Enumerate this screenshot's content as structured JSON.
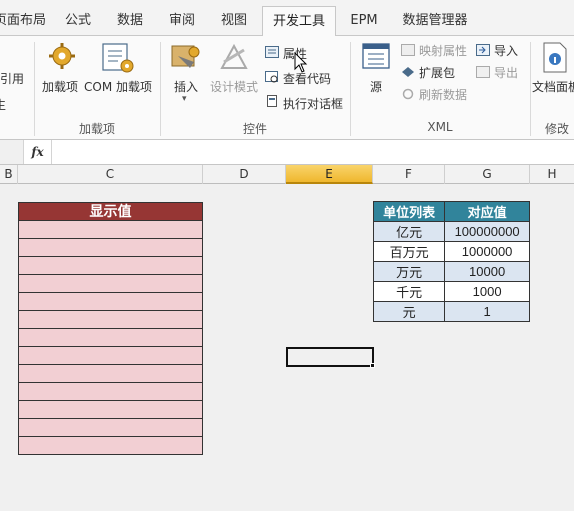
{
  "tabs": [
    "页面布局",
    "公式",
    "数据",
    "审阅",
    "视图",
    "开发工具",
    "EPM",
    "数据管理器"
  ],
  "active_tab": "开发工具",
  "ribbon": {
    "left_cut_texts": [
      "引用",
      "生"
    ],
    "addins": {
      "addin1": "加载项",
      "com": "COM",
      "addin2": "加载项",
      "group": "加载项"
    },
    "controls": {
      "insert": "插入",
      "design_mode": "设计模式",
      "properties": "属性",
      "view_code": "查看代码",
      "run_dialog": "执行对话框",
      "group": "控件"
    },
    "xml": {
      "source": "源",
      "map_props": "映射属性",
      "expansion": "扩展包",
      "refresh": "刷新数据",
      "import": "导入",
      "export": "导出",
      "group": "XML"
    },
    "modify": {
      "doc_panel": "文档面板",
      "group": "修改"
    }
  },
  "formula_bar": {
    "fx": "fx",
    "value": ""
  },
  "columns": [
    "B",
    "C",
    "D",
    "E",
    "F",
    "G",
    "H"
  ],
  "selected_column": "E",
  "display_table": {
    "header": "显示值",
    "rows": 13
  },
  "unit_table": {
    "headers": [
      "单位列表",
      "对应值"
    ],
    "rows": [
      {
        "unit": "亿元",
        "value": "100000000"
      },
      {
        "unit": "百万元",
        "value": "1000000"
      },
      {
        "unit": "万元",
        "value": "10000"
      },
      {
        "unit": "千元",
        "value": "1000"
      },
      {
        "unit": "元",
        "value": "1"
      }
    ]
  },
  "colors": {
    "display_header": "#963634",
    "display_fill": "#f2cfd3",
    "unit_header": "#31849b",
    "unit_band": "#dbe5f1",
    "selected_col": "#f5c342"
  }
}
